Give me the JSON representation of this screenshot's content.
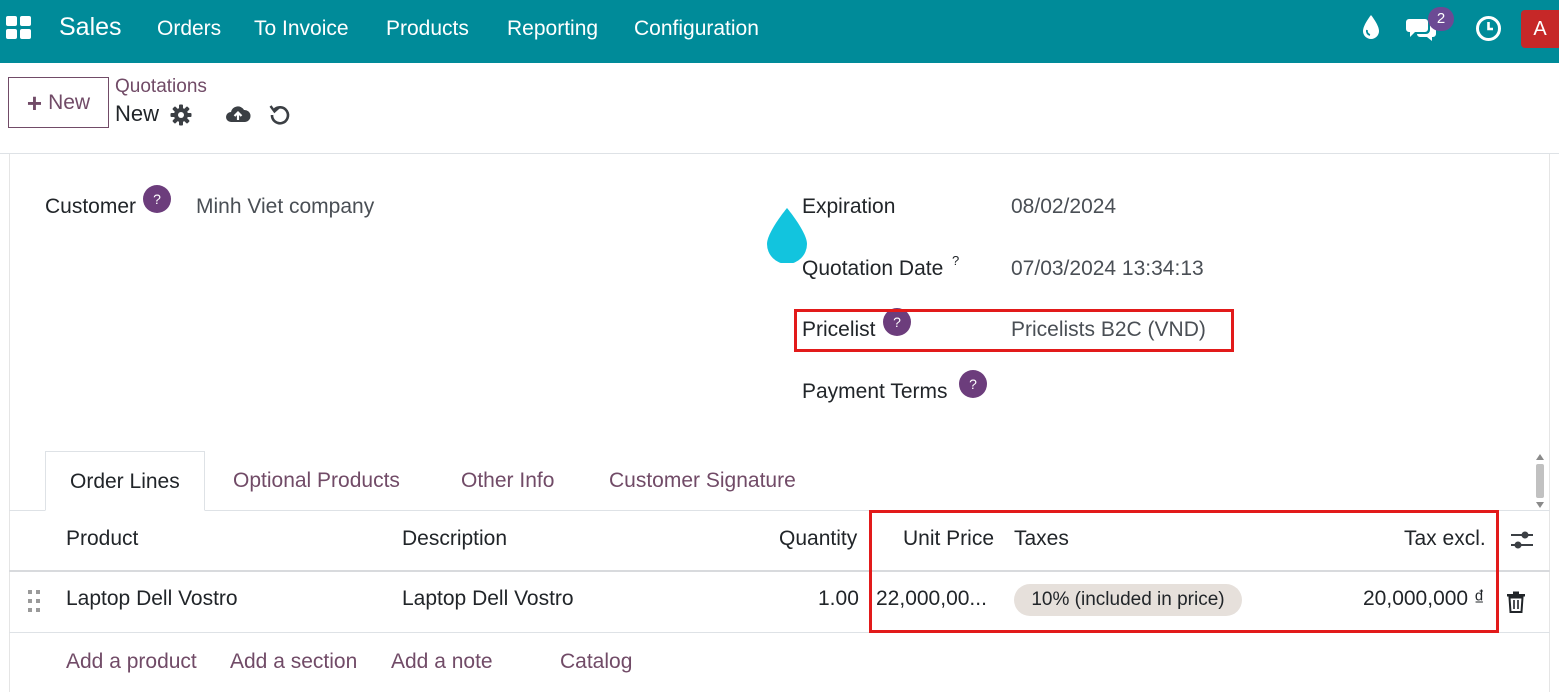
{
  "navbar": {
    "brand": "Sales",
    "menu": [
      "Orders",
      "To Invoice",
      "Products",
      "Reporting",
      "Configuration"
    ],
    "icons": [
      "apps-grid-icon",
      "droplet-icon",
      "chat-icon",
      "clock-icon"
    ],
    "chat_count": "2",
    "avatar_letter": "A"
  },
  "control_panel": {
    "new_button": "New",
    "breadcrumb": "Quotations",
    "record_name": "New",
    "icons": [
      "gear-icon",
      "cloud-upload-icon",
      "discard-icon"
    ]
  },
  "form": {
    "customer_label": "Customer",
    "customer_value": "Minh Viet company",
    "expiration_label": "Expiration",
    "expiration_value": "08/02/2024",
    "quotation_date_label": "Quotation Date",
    "quotation_date_value": "07/03/2024 13:34:13",
    "pricelist_label": "Pricelist",
    "pricelist_value": "Pricelists B2C (VND)",
    "payment_terms_label": "Payment Terms",
    "help_mark": "?"
  },
  "tabs": [
    "Order Lines",
    "Optional Products",
    "Other Info",
    "Customer Signature"
  ],
  "order_lines": {
    "columns": [
      "Product",
      "Description",
      "Quantity",
      "Unit Price",
      "Taxes",
      "Tax excl."
    ],
    "rows": [
      {
        "product": "Laptop Dell Vostro",
        "description": "Laptop Dell Vostro",
        "quantity": "1.00",
        "unit_price": "22,000,00...",
        "taxes": "10% (included in price)",
        "tax_excl": "20,000,000 ₫"
      }
    ],
    "add_links": [
      "Add a product",
      "Add a section",
      "Add a note",
      "Catalog"
    ]
  },
  "colors": {
    "navbar": "#008b99",
    "accent": "#714b67",
    "help_badge": "#6c3d7c",
    "highlight_box": "#e21a1a",
    "tax_badge": "#e6e0db",
    "avatar": "#c62828",
    "droplet": "#12c4de"
  }
}
